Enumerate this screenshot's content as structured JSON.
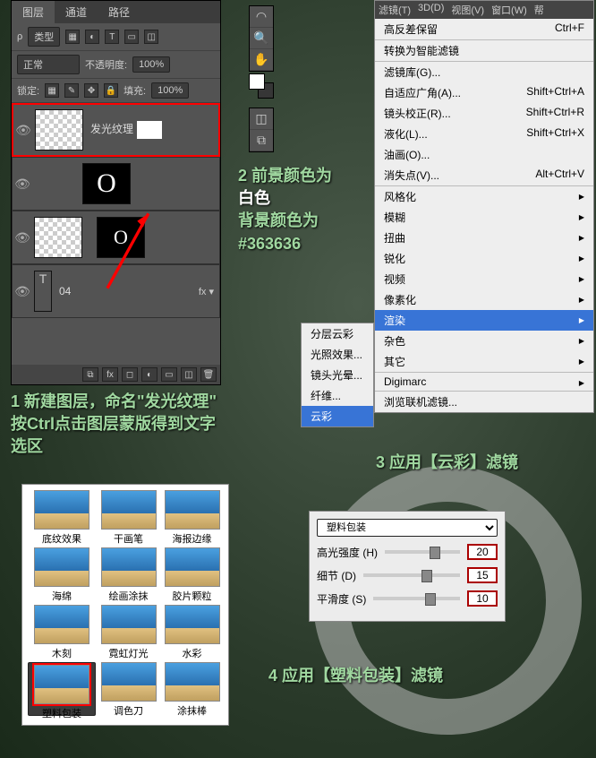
{
  "layers_panel": {
    "tabs": [
      "图层",
      "通道",
      "路径"
    ],
    "type_label": "类型",
    "blend_mode": "正常",
    "opacity_label": "不透明度:",
    "opacity_value": "100%",
    "lock_label": "锁定:",
    "fill_label": "填充:",
    "fill_value": "100%",
    "layers": [
      {
        "name": "发光纹理",
        "thumb": "checker",
        "highlighted": true
      },
      {
        "name": "",
        "thumb": "O"
      },
      {
        "name": "",
        "thumb": "O-small"
      },
      {
        "name": "04",
        "thumb": "text"
      }
    ]
  },
  "annotations": {
    "a1": "1 新建图层，命名\"发光纹理\" 按Ctrl点击图层蒙版得到文字选区",
    "a2_line1": "2 前景颜色为",
    "a2_white": "白色",
    "a2_line2": "背景颜色为",
    "a2_hex": "#363636",
    "a3": "3 应用【云彩】滤镜",
    "a4": "4 应用【塑料包装】滤镜"
  },
  "filter_menu": {
    "menubar": [
      "滤镜(T)",
      "3D(D)",
      "视图(V)",
      "窗口(W)",
      "帮"
    ],
    "items": [
      {
        "label": "高反差保留",
        "shortcut": "Ctrl+F"
      },
      {
        "label": "转换为智能滤镜",
        "sep": true
      },
      {
        "label": "滤镜库(G)...",
        "sep": true
      },
      {
        "label": "自适应广角(A)...",
        "shortcut": "Shift+Ctrl+A"
      },
      {
        "label": "镜头校正(R)...",
        "shortcut": "Shift+Ctrl+R"
      },
      {
        "label": "液化(L)...",
        "shortcut": "Shift+Ctrl+X"
      },
      {
        "label": "油画(O)..."
      },
      {
        "label": "消失点(V)...",
        "shortcut": "Alt+Ctrl+V"
      },
      {
        "label": "风格化",
        "arrow": true,
        "sep": true
      },
      {
        "label": "模糊",
        "arrow": true
      },
      {
        "label": "扭曲",
        "arrow": true
      },
      {
        "label": "锐化",
        "arrow": true
      },
      {
        "label": "视频",
        "arrow": true
      },
      {
        "label": "像素化",
        "arrow": true
      },
      {
        "label": "渲染",
        "arrow": true,
        "highlighted": true
      },
      {
        "label": "杂色",
        "arrow": true
      },
      {
        "label": "其它",
        "arrow": true
      },
      {
        "label": "Digimarc",
        "arrow": true,
        "sep": true
      },
      {
        "label": "浏览联机滤镜...",
        "sep": true
      }
    ],
    "submenu": [
      {
        "label": "分层云彩"
      },
      {
        "label": "光照效果..."
      },
      {
        "label": "镜头光晕..."
      },
      {
        "label": "纤维..."
      },
      {
        "label": "云彩",
        "highlighted": true
      }
    ]
  },
  "gallery": {
    "items": [
      "底纹效果",
      "干画笔",
      "海报边缘",
      "海绵",
      "绘画涂抹",
      "胶片颗粒",
      "木刻",
      "霓虹灯光",
      "水彩",
      "塑料包装",
      "调色刀",
      "涂抹棒"
    ],
    "selected": "塑料包装"
  },
  "plastic_wrap": {
    "title": "塑料包装",
    "rows": [
      {
        "label": "高光强度 (H)",
        "value": "20"
      },
      {
        "label": "细节 (D)",
        "value": "15"
      },
      {
        "label": "平滑度 (S)",
        "value": "10"
      }
    ]
  }
}
